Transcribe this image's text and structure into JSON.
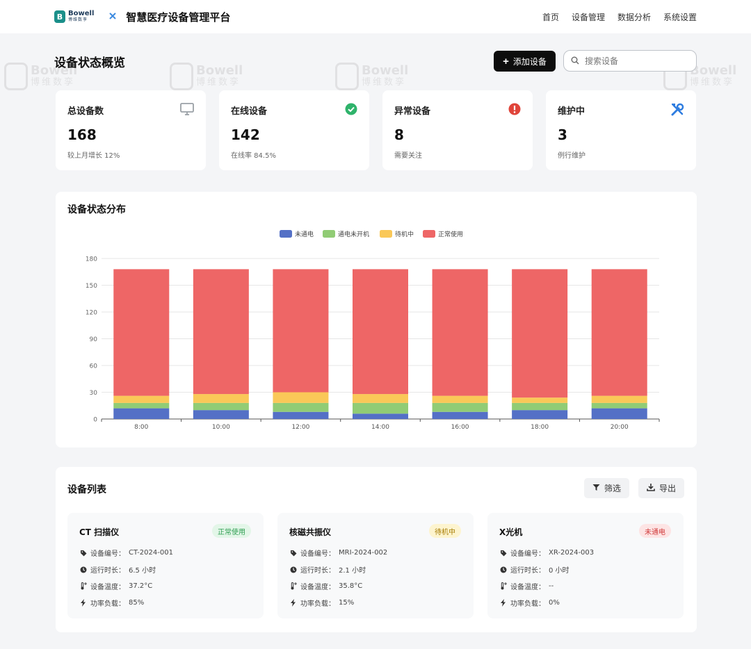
{
  "brand": {
    "logo_letter": "B",
    "name_en": "Bowell",
    "name_cn": "博维数孪"
  },
  "app_title": "智慧医疗设备管理平台",
  "nav": [
    "首页",
    "设备管理",
    "数据分析",
    "系统设置"
  ],
  "page_title": "设备状态概览",
  "add_button": "添加设备",
  "search": {
    "placeholder": "搜索设备",
    "value": ""
  },
  "stats": [
    {
      "label": "总设备数",
      "value": "168",
      "sub": "较上月增长 12%",
      "icon": "monitor-icon",
      "color": "#9aa0a6"
    },
    {
      "label": "在线设备",
      "value": "142",
      "sub": "在线率 84.5%",
      "icon": "check-circle-icon",
      "color": "#2fb36b"
    },
    {
      "label": "异常设备",
      "value": "8",
      "sub": "需要关注",
      "icon": "alert-circle-icon",
      "color": "#e0443a"
    },
    {
      "label": "维护中",
      "value": "3",
      "sub": "例行维护",
      "icon": "tools-icon",
      "color": "#2f7de0"
    }
  ],
  "chart_section_title": "设备状态分布",
  "chart_data": {
    "type": "bar",
    "stacked": true,
    "categories": [
      "8:00",
      "10:00",
      "12:00",
      "14:00",
      "16:00",
      "18:00",
      "20:00"
    ],
    "series": [
      {
        "name": "未通电",
        "color": "#5470c6",
        "values": [
          12,
          10,
          8,
          6,
          8,
          10,
          12
        ]
      },
      {
        "name": "通电未开机",
        "color": "#91cc75",
        "values": [
          6,
          8,
          10,
          12,
          10,
          8,
          6
        ]
      },
      {
        "name": "待机中",
        "color": "#fac858",
        "values": [
          8,
          10,
          12,
          10,
          8,
          6,
          8
        ]
      },
      {
        "name": "正常使用",
        "color": "#ee6666",
        "values": [
          142,
          140,
          138,
          140,
          142,
          144,
          142
        ]
      }
    ],
    "ylim": [
      0,
      180
    ],
    "yticks": [
      0,
      30,
      60,
      90,
      120,
      150,
      180
    ],
    "grid": true,
    "legend": "top-center"
  },
  "list_section_title": "设备列表",
  "filter_label": "筛选",
  "export_label": "导出",
  "devices": [
    {
      "name": "CT 扫描仪",
      "status": "正常使用",
      "status_bg": "#e3f6e8",
      "status_color": "#2f9e52",
      "rows": [
        {
          "label": "设备编号：",
          "value": "CT-2024-001",
          "icon": "tag-icon"
        },
        {
          "label": "运行时长：",
          "value": "6.5 小时",
          "icon": "clock-icon"
        },
        {
          "label": "设备温度：",
          "value": "37.2°C",
          "icon": "thermometer-icon"
        },
        {
          "label": "功率负载：",
          "value": "85%",
          "icon": "bolt-icon"
        }
      ]
    },
    {
      "name": "核磁共振仪",
      "status": "待机中",
      "status_bg": "#fdf4cf",
      "status_color": "#a67b00",
      "rows": [
        {
          "label": "设备编号：",
          "value": "MRI-2024-002",
          "icon": "tag-icon"
        },
        {
          "label": "运行时长：",
          "value": "2.1 小时",
          "icon": "clock-icon"
        },
        {
          "label": "设备温度：",
          "value": "35.8°C",
          "icon": "thermometer-icon"
        },
        {
          "label": "功率负载：",
          "value": "15%",
          "icon": "bolt-icon"
        }
      ]
    },
    {
      "name": "X光机",
      "status": "未通电",
      "status_bg": "#fde4e4",
      "status_color": "#d03a3a",
      "rows": [
        {
          "label": "设备编号：",
          "value": "XR-2024-003",
          "icon": "tag-icon"
        },
        {
          "label": "运行时长：",
          "value": "0 小时",
          "icon": "clock-icon"
        },
        {
          "label": "设备温度：",
          "value": "--",
          "icon": "thermometer-icon"
        },
        {
          "label": "功率负载：",
          "value": "0%",
          "icon": "bolt-icon"
        }
      ]
    }
  ]
}
